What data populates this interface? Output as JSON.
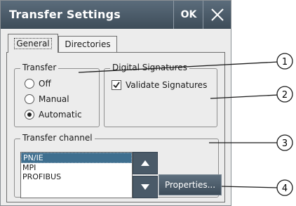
{
  "window": {
    "title": "Transfer Settings",
    "ok_label": "OK",
    "close_icon": "close-icon"
  },
  "tabs": [
    {
      "label": "General",
      "active": true
    },
    {
      "label": "Directories",
      "active": false
    }
  ],
  "transfer_group": {
    "legend": "Transfer",
    "options": [
      {
        "label": "Off",
        "selected": false
      },
      {
        "label": "Manual",
        "selected": false
      },
      {
        "label": "Automatic",
        "selected": true
      }
    ]
  },
  "signatures_group": {
    "legend": "Digital Signatures",
    "validate_label": "Validate Signatures",
    "validate_checked": true
  },
  "channel_group": {
    "legend": "Transfer channel",
    "items": [
      "PN/IE",
      "MPI",
      "PROFIBUS"
    ],
    "selected_index": 0,
    "scroll_up_icon": "triangle-up-icon",
    "scroll_down_icon": "triangle-down-icon",
    "properties_label": "Properties..."
  },
  "callouts": [
    "1",
    "2",
    "3",
    "4"
  ],
  "colors": {
    "titlebar": "#4a5a68",
    "selection": "#3f6f8f",
    "dialog_bg": "#ececec"
  }
}
